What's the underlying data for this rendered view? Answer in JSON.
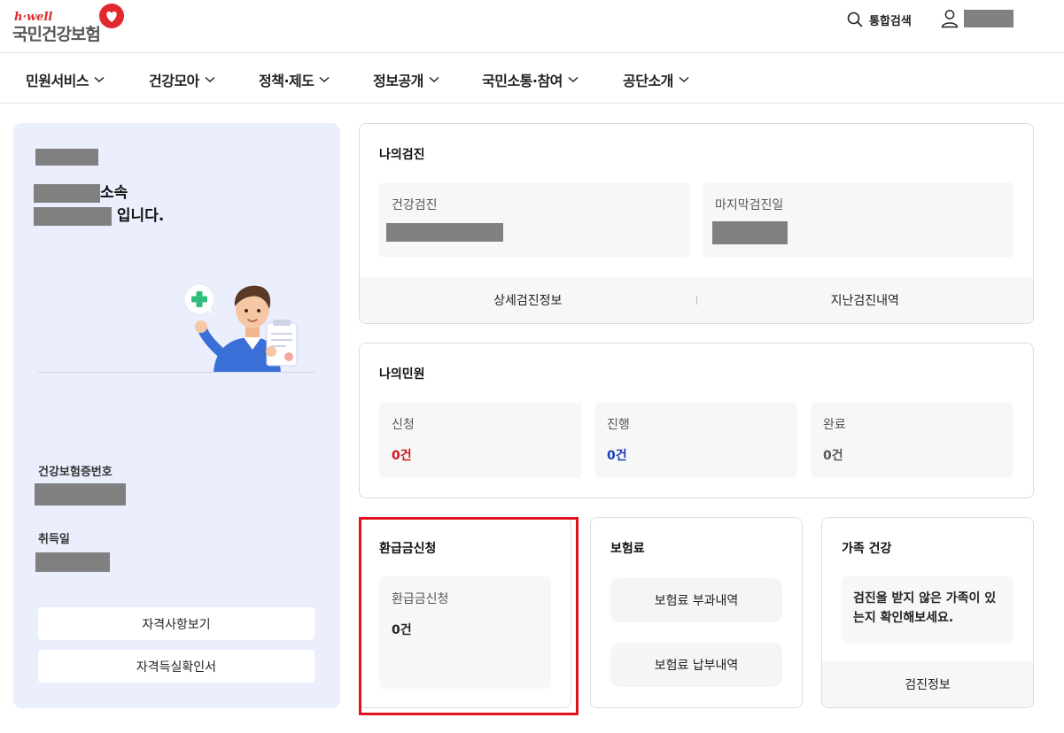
{
  "header": {
    "logo_sub": "h·well",
    "logo_main": "국민건강보험",
    "search_label": "통합검색",
    "brand_color": "#e0282e"
  },
  "gnb": {
    "items": [
      {
        "label": "민원서비스"
      },
      {
        "label": "건강모아"
      },
      {
        "label": "정책·제도"
      },
      {
        "label": "정보공개"
      },
      {
        "label": "국민소통·참여"
      },
      {
        "label": "공단소개"
      }
    ]
  },
  "profile": {
    "affiliation_suffix": "소속",
    "greeting_suffix": " 입니다.",
    "insurance_no_label": "건강보험증번호",
    "acquired_date_label": "취득일",
    "btn_qualification": "자격사항보기",
    "btn_certificate": "자격득실확인서"
  },
  "checkup": {
    "title": "나의검진",
    "box1_label": "건강검진",
    "box2_label": "마지막검진일",
    "link_detail": "상세검진정보",
    "link_history": "지난검진내역"
  },
  "civil": {
    "title": "나의민원",
    "items": [
      {
        "label": "신청",
        "value": "0건",
        "color": "#d3141b"
      },
      {
        "label": "진행",
        "value": "0건",
        "color": "#1b3fb8"
      },
      {
        "label": "완료",
        "value": "0건",
        "color": "#555555"
      }
    ]
  },
  "refund": {
    "title": "환급금신청",
    "box_label": "환급금신청",
    "box_value": "0건"
  },
  "premium": {
    "title": "보험료",
    "btn_assessment": "보험료 부과내역",
    "btn_payment": "보험료 납부내역"
  },
  "family": {
    "title": "가족 건강",
    "message": "검진을 받지 않은 가족이 있는지 확인해보세요.",
    "link": "검진정보"
  }
}
